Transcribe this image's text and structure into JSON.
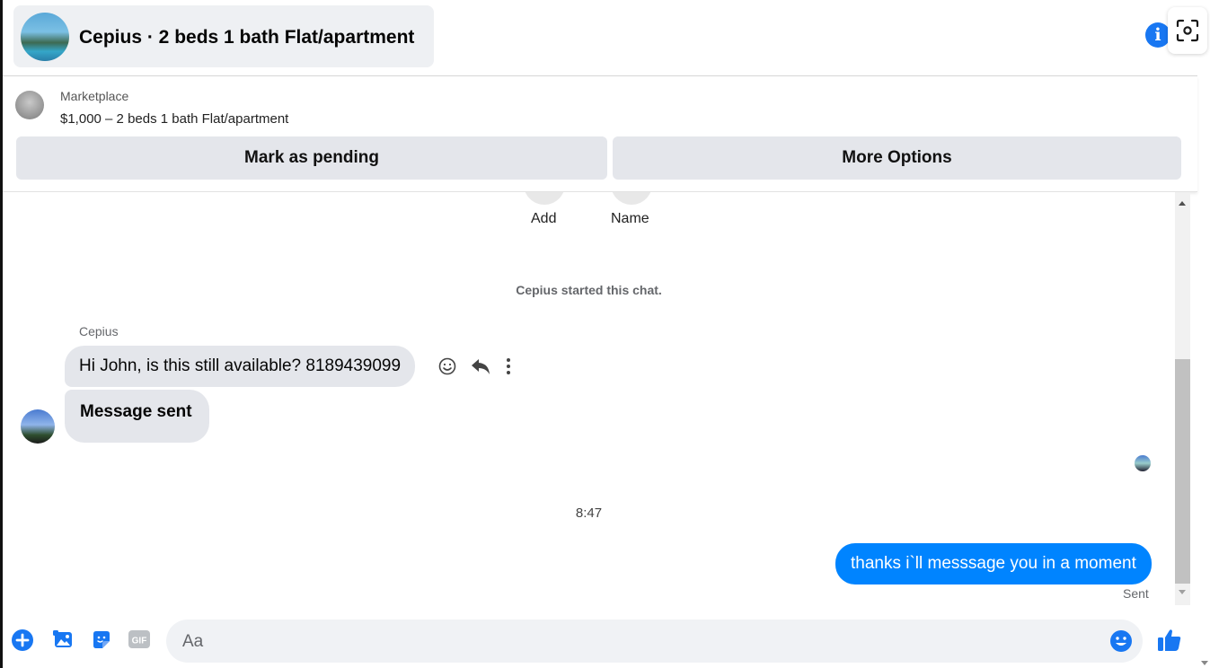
{
  "header": {
    "title": "Cepius · 2 beds 1 bath Flat/apartment",
    "info_icon": "info-icon",
    "scan_icon": "screen-capture-icon"
  },
  "listing": {
    "source": "Marketplace",
    "price_title": "$1,000 – 2 beds 1 bath Flat/apartment",
    "mark_pending_label": "Mark as pending",
    "more_options_label": "More Options"
  },
  "actions": {
    "add_label": "Add",
    "name_label": "Name"
  },
  "conversation": {
    "system_message": "Cepius started this chat.",
    "sender_name": "Cepius",
    "incoming": [
      "Hi John, is this still available? 8189439099",
      "Message sent"
    ],
    "timestamp": "8:47",
    "outgoing": "thanks i`ll messsage you in a moment",
    "status": "Sent"
  },
  "composer": {
    "placeholder": "Aa",
    "icons": [
      "plus-circle-icon",
      "photo-icon",
      "sticker-icon",
      "gif-icon",
      "emoji-icon",
      "thumbs-up-icon"
    ],
    "gif_text": "GIF"
  },
  "colors": {
    "accent": "#1877f2",
    "outgoing_bubble": "#0084ff",
    "incoming_bubble": "#e4e6eb",
    "button_bg": "#e4e6eb"
  }
}
